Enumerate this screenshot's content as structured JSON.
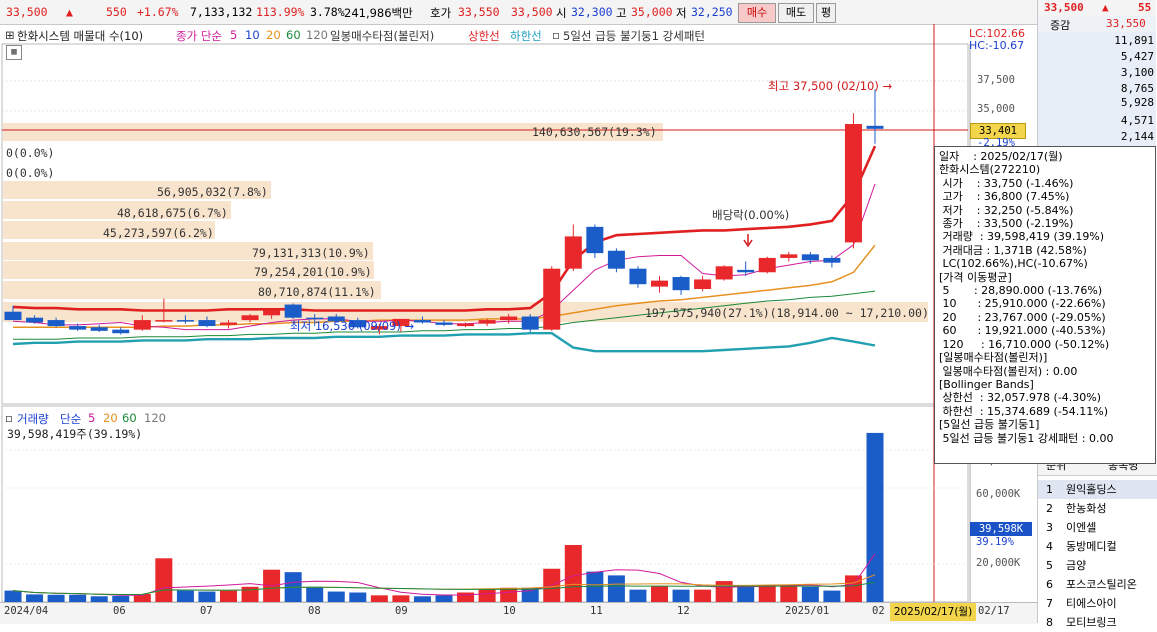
{
  "ticker": {
    "price": "33,500",
    "up_arrow": "▲",
    "change": "550",
    "change_pct": "+1.67%",
    "volume": "7,133,132",
    "vol_ratio": "113.99%",
    "turnover": "3.78%",
    "amount": "241,986백만",
    "ask_label": "호가",
    "ask": "33,550",
    "bid": "33,500",
    "open_label": "시",
    "open": "32,300",
    "high_label": "고",
    "high": "35,000",
    "low_label": "저",
    "low": "32,250",
    "buy_btn": "매수",
    "sell_btn": "매도",
    "eval_btn": "평"
  },
  "legend": {
    "title": "한화시스템 매물대 수(10)",
    "ma_label": "종가 단순",
    "ma5": "5",
    "ma10": "10",
    "ma20": "20",
    "ma60": "60",
    "ma120": "120",
    "bb_label": "일봉매수타점(볼린저)",
    "upper": "상한선",
    "lower": "하한선",
    "pattern": "5일선 급등 불기둥1 강세패턴",
    "lc": "LC:102.66",
    "hc": "HC:-10.67"
  },
  "orderbook": {
    "price": "33,500",
    "arrow": "▲",
    "change": "55",
    "label": "증감",
    "ask_top": "33,550",
    "rows": [
      "11,891",
      "5,427",
      "3,100",
      "8,765",
      "5,928",
      "4,571",
      "2,144"
    ]
  },
  "price_axis": [
    "37,500",
    "35,000",
    "33,401",
    "-2.19%"
  ],
  "annotations": {
    "high_note": "최고 37,500 (02/10) →",
    "low_note": "최저 16,530 (09/09) →",
    "dividend": "배당락(0.00%)",
    "vp_top": "140,630,567(19.3%)",
    "vp_zero1": "0(0.0%)",
    "vp_zero2": "0(0.0%)",
    "vp1": "56,905,032(7.8%)",
    "vp2": "48,618,675(6.7%)",
    "vp3": "45,273,597(6.2%)",
    "vp4": "79,131,313(10.9%)",
    "vp5": "79,254,201(10.9%)",
    "vp6": "80,710,874(11.1%)",
    "vp7": "197,575,940(27.1%)(18,914.00 ~ 17,210.00)"
  },
  "infobox": [
    "일자    : 2025/02/17(월)",
    "한화시스템(272210)",
    " 시가    : 33,750 (-1.46%)",
    " 고가    : 36,800 (7.45%)",
    " 저가    : 32,250 (-5.84%)",
    " 종가    : 33,500 (-2.19%)",
    " 거래량  : 39,598,419 (39.19%)",
    " 거래대금 : 1,371B (42.58%)",
    " LC(102.66%),HC(-10.67%)",
    "[가격 이동평균]",
    " 5       : 28,890.000 (-13.76%)",
    " 10      : 25,910.000 (-22.66%)",
    " 20      : 23,767.000 (-29.05%)",
    " 60      : 19,921.000 (-40.53%)",
    " 120     : 16,710.000 (-50.12%)",
    "[일봉매수타점(볼린저)]",
    " 일봉매수타점(볼린저) : 0.00",
    "[Bollinger Bands]",
    " 상한선  : 32,057.978 (-4.30%)",
    " 하한선  : 15,374.689 (-54.11%)",
    "[5일선 급등 불기둥1]",
    " 5일선 급등 불기둥1 강세패턴 : 0.00"
  ],
  "volume_legend": {
    "label": "거래량",
    "ma_label": "단순",
    "ma5": "5",
    "ma20": "20",
    "ma60": "60",
    "ma120": "120",
    "current": "39,598,419주(39.19%)"
  },
  "volume_axis": [
    "80,000K",
    "60,000K",
    "39,598K",
    "39.19%",
    "20,000K"
  ],
  "date_axis": [
    "2024/04",
    "06",
    "07",
    "08",
    "09",
    "10",
    "11",
    "12",
    "2025/01",
    "02",
    "2025/02/17(월)",
    "02/17"
  ],
  "ranking": {
    "header_left": "순위",
    "header_right": "종목명",
    "items": [
      {
        "rank": "1",
        "name": "원익홀딩스"
      },
      {
        "rank": "2",
        "name": "한농화성"
      },
      {
        "rank": "3",
        "name": "이엔셀"
      },
      {
        "rank": "4",
        "name": "동방메디컬"
      },
      {
        "rank": "5",
        "name": "금양"
      },
      {
        "rank": "6",
        "name": "포스코스틸리온"
      },
      {
        "rank": "7",
        "name": "티에스아이"
      },
      {
        "rank": "8",
        "name": "모티브링크"
      }
    ]
  },
  "chart_data": {
    "type": "candlestick",
    "title": "한화시스템",
    "candles": [
      {
        "o": 18200,
        "h": 18700,
        "l": 17700,
        "c": 17500
      },
      {
        "o": 17700,
        "h": 17900,
        "l": 17200,
        "c": 17300
      },
      {
        "o": 17500,
        "h": 17700,
        "l": 16900,
        "c": 17000
      },
      {
        "o": 17000,
        "h": 17200,
        "l": 16600,
        "c": 16700
      },
      {
        "o": 16900,
        "h": 17100,
        "l": 16500,
        "c": 16600
      },
      {
        "o": 16700,
        "h": 16900,
        "l": 16300,
        "c": 16400
      },
      {
        "o": 16700,
        "h": 17900,
        "l": 16600,
        "c": 17500
      },
      {
        "o": 17500,
        "h": 19300,
        "l": 17300,
        "c": 17500
      },
      {
        "o": 17500,
        "h": 17900,
        "l": 17200,
        "c": 17400
      },
      {
        "o": 17500,
        "h": 17800,
        "l": 16900,
        "c": 17000
      },
      {
        "o": 17100,
        "h": 17500,
        "l": 16800,
        "c": 17300
      },
      {
        "o": 17500,
        "h": 18000,
        "l": 17300,
        "c": 17900
      },
      {
        "o": 17900,
        "h": 18500,
        "l": 17600,
        "c": 18300
      },
      {
        "o": 18800,
        "h": 18900,
        "l": 17600,
        "c": 17700
      },
      {
        "o": 17700,
        "h": 18000,
        "l": 17000,
        "c": 17600
      },
      {
        "o": 17800,
        "h": 18000,
        "l": 17300,
        "c": 17400
      },
      {
        "o": 17500,
        "h": 17700,
        "l": 16800,
        "c": 16900
      },
      {
        "o": 16700,
        "h": 17200,
        "l": 16300,
        "c": 17000
      },
      {
        "o": 17000,
        "h": 17400,
        "l": 16500,
        "c": 17600
      },
      {
        "o": 17500,
        "h": 17800,
        "l": 17200,
        "c": 17300
      },
      {
        "o": 17300,
        "h": 17500,
        "l": 17000,
        "c": 17100
      },
      {
        "o": 17000,
        "h": 17300,
        "l": 16900,
        "c": 17200
      },
      {
        "o": 17200,
        "h": 17600,
        "l": 17000,
        "c": 17500
      },
      {
        "o": 17500,
        "h": 18000,
        "l": 17200,
        "c": 17800
      },
      {
        "o": 17800,
        "h": 18000,
        "l": 16500,
        "c": 16700
      },
      {
        "o": 16700,
        "h": 22000,
        "l": 16600,
        "c": 21800
      },
      {
        "o": 21800,
        "h": 25500,
        "l": 21600,
        "c": 24500
      },
      {
        "o": 25300,
        "h": 25500,
        "l": 22700,
        "c": 23100
      },
      {
        "o": 23300,
        "h": 23500,
        "l": 21500,
        "c": 21800
      },
      {
        "o": 21800,
        "h": 22000,
        "l": 20200,
        "c": 20500
      },
      {
        "o": 20300,
        "h": 21200,
        "l": 19800,
        "c": 20800
      },
      {
        "o": 21100,
        "h": 21200,
        "l": 19600,
        "c": 20000
      },
      {
        "o": 20100,
        "h": 21200,
        "l": 19900,
        "c": 20900
      },
      {
        "o": 20900,
        "h": 22100,
        "l": 20800,
        "c": 22000
      },
      {
        "o": 21700,
        "h": 22400,
        "l": 21200,
        "c": 21500
      },
      {
        "o": 21500,
        "h": 22800,
        "l": 21400,
        "c": 22700
      },
      {
        "o": 22700,
        "h": 23200,
        "l": 22400,
        "c": 23000
      },
      {
        "o": 23000,
        "h": 23200,
        "l": 22200,
        "c": 22500
      },
      {
        "o": 22700,
        "h": 22900,
        "l": 21900,
        "c": 22300
      },
      {
        "o": 24000,
        "h": 34800,
        "l": 23500,
        "c": 33900
      },
      {
        "o": 33750,
        "h": 36800,
        "l": 32250,
        "c": 33500
      }
    ],
    "volumes": [
      6000,
      4000,
      3800,
      3800,
      3000,
      3200,
      4200,
      23000,
      6000,
      5500,
      6000,
      8000,
      17000,
      15700,
      8000,
      5500,
      5000,
      3500,
      3500,
      3000,
      3500,
      5000,
      6500,
      7500,
      7500,
      17500,
      30000,
      16000,
      14000,
      6500,
      8500,
      6500,
      6500,
      11000,
      8000,
      9000,
      9000,
      8000,
      6000,
      14000,
      89000,
      39600
    ],
    "ma5_price": [
      17400,
      17300,
      17100,
      17100,
      17200,
      17300,
      17000,
      16900,
      16700,
      16700,
      16700,
      17000,
      17300,
      17500,
      17600,
      17600,
      17400,
      17400,
      17500,
      17400,
      17200,
      17200,
      17300,
      17400,
      17400,
      18300,
      20000,
      21700,
      22500,
      22800,
      22900,
      22900,
      21400,
      21200,
      21300,
      21800,
      22100,
      22400,
      22500,
      23800,
      28890
    ],
    "ma20_price": [
      16900,
      16900,
      16900,
      16900,
      16900,
      16900,
      16900,
      17000,
      17000,
      17100,
      17100,
      17200,
      17200,
      17300,
      17300,
      17400,
      17400,
      17500,
      17500,
      17500,
      17500,
      17500,
      17600,
      17600,
      17600,
      17800,
      18100,
      18400,
      18700,
      18900,
      19100,
      19200,
      19400,
      19600,
      19800,
      20000,
      20200,
      20400,
      20700,
      21500,
      23767
    ],
    "ma60_price": [
      15900,
      15900,
      15900,
      16000,
      16000,
      16000,
      16100,
      16100,
      16100,
      16200,
      16200,
      16300,
      16300,
      16400,
      16400,
      16500,
      16500,
      16500,
      16500,
      16600,
      16600,
      16700,
      16700,
      16800,
      16800,
      17000,
      17300,
      17500,
      17700,
      17900,
      18100,
      18300,
      18500,
      18700,
      18900,
      19100,
      19200,
      19400,
      19500,
      19700,
      19921
    ],
    "bb_lower": [
      15500,
      15600,
      15600,
      15700,
      15700,
      15700,
      15800,
      15800,
      15800,
      15900,
      15900,
      15900,
      16000,
      16000,
      16000,
      16100,
      16100,
      16100,
      16200,
      16200,
      16200,
      16300,
      16300,
      16300,
      16400,
      16400,
      15200,
      14900,
      14900,
      14900,
      14900,
      14900,
      14900,
      15000,
      15100,
      15200,
      15300,
      15600,
      16000,
      15700,
      15374
    ],
    "bb_upper": [
      18600,
      18500,
      18500,
      18400,
      18400,
      18400,
      18300,
      18300,
      18300,
      18300,
      18400,
      18400,
      18400,
      18400,
      18300,
      18300,
      18300,
      18300,
      18300,
      18300,
      18300,
      18300,
      18400,
      18400,
      18500,
      19800,
      22500,
      24000,
      24600,
      24700,
      24800,
      24900,
      25000,
      25000,
      25100,
      25200,
      25300,
      25500,
      25800,
      28000,
      32058
    ],
    "x_labels": [
      "2024/04",
      "06",
      "07",
      "08",
      "09",
      "10",
      "11",
      "12",
      "2025/01",
      "02"
    ]
  }
}
